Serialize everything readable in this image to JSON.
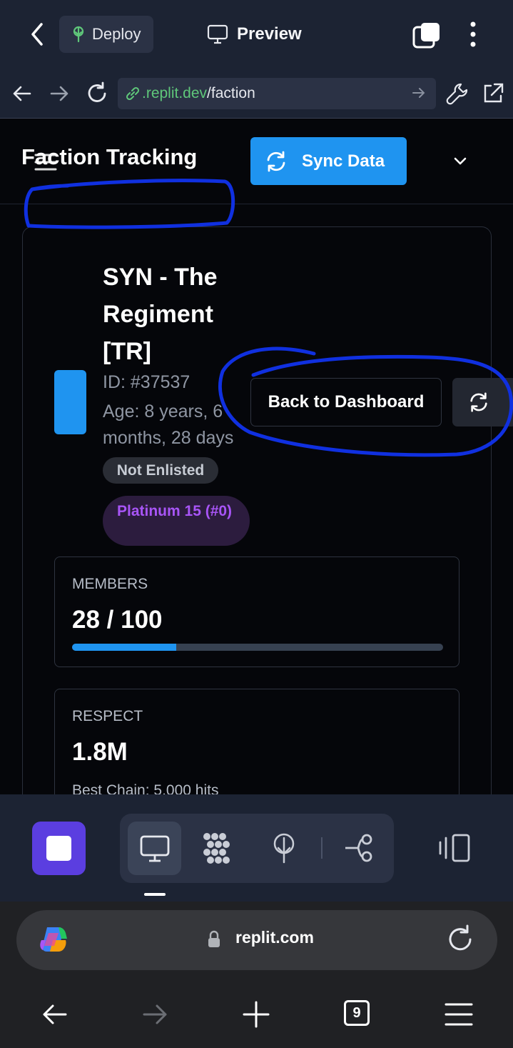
{
  "top_bar": {
    "deploy_label": "Deploy",
    "preview_label": "Preview"
  },
  "url_bar": {
    "host": ".replit.dev",
    "path": "/faction"
  },
  "app_header": {
    "title": "Faction Tracking",
    "sync_label": "Sync Data"
  },
  "faction": {
    "name": "SYN - The Regiment [TR]",
    "id_text": "ID: #37537",
    "age_text": "Age: 8 years, 6 months, 28 days",
    "enlist_badge": "Not Enlisted",
    "rank_badge": "Platinum 15 (#0)",
    "back_button": "Back to Dashboard"
  },
  "stats": {
    "members": {
      "label": "MEMBERS",
      "value": "28 / 100",
      "progress_fraction": 0.28
    },
    "respect": {
      "label": "RESPECT",
      "value": "1.8M",
      "sub": "Best Chain: 5,000 hits"
    }
  },
  "browser": {
    "address": "replit.com",
    "tab_count": "9"
  },
  "colors": {
    "accent": "#1f94f0",
    "rank_purple": "#a855f7",
    "annotation_ink": "#1030e0",
    "toolbar_bg": "#1c2333"
  },
  "icons": [
    "chevron-left-icon",
    "deploy-icon",
    "monitor-icon",
    "tabs-icon",
    "kebab-icon",
    "arrow-left-icon",
    "arrow-right-icon",
    "reload-icon",
    "link-icon",
    "wrench-icon",
    "external-link-icon",
    "hamburger-icon",
    "sync-icon",
    "chevron-down-icon",
    "refresh-icon",
    "stop-icon",
    "grid-icon",
    "deploy-tool-icon",
    "git-icon",
    "side-panel-icon",
    "copilot-icon",
    "lock-icon",
    "plus-icon",
    "menu-icon"
  ]
}
